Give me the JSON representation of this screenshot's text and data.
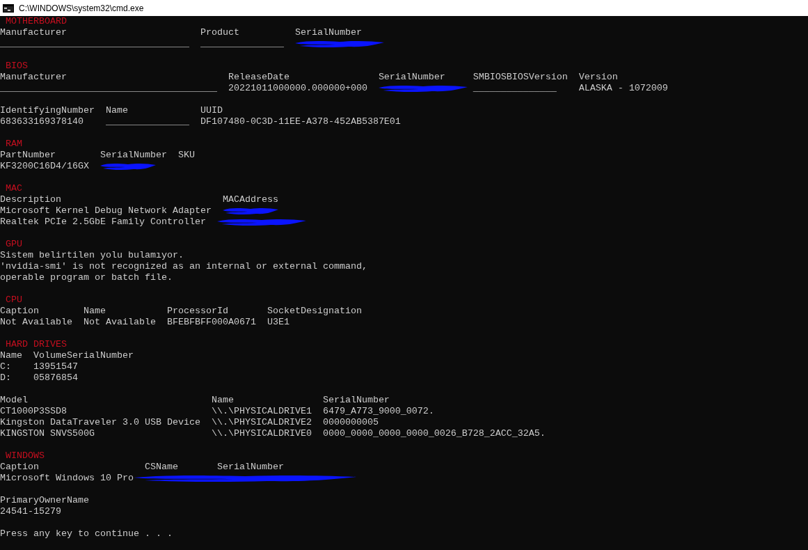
{
  "window": {
    "title": "C:\\WINDOWS\\system32\\cmd.exe"
  },
  "lines": [
    {
      "kind": "heading",
      "text": " MOTHERBOARD"
    },
    {
      "kind": "text",
      "text": "Manufacturer                        Product          SerialNumber"
    },
    {
      "kind": "text",
      "text": "__________________________________  _______________  ",
      "redaction": {
        "kind": "medium"
      }
    },
    {
      "kind": "blank"
    },
    {
      "kind": "heading",
      "text": " BIOS"
    },
    {
      "kind": "text",
      "text": "Manufacturer                             ReleaseDate                SerialNumber     SMBIOSBIOSVersion  Version"
    },
    {
      "kind": "text",
      "text": "_______________________________________  20221011000000.000000+000  ",
      "redaction": {
        "kind": "medium"
      },
      "after": " _______________    ALASKA - 1072009"
    },
    {
      "kind": "blank"
    },
    {
      "kind": "text",
      "text": "IdentifyingNumber  Name             UUID"
    },
    {
      "kind": "text",
      "text": "683633169378140    _______________  DF107480-0C3D-11EE-A378-452AB5387E01"
    },
    {
      "kind": "blank"
    },
    {
      "kind": "heading",
      "text": " RAM"
    },
    {
      "kind": "text",
      "text": "PartNumber        SerialNumber  SKU"
    },
    {
      "kind": "text",
      "text": "KF3200C16D4/16GX  ",
      "redaction": {
        "kind": "short"
      }
    },
    {
      "kind": "blank"
    },
    {
      "kind": "heading",
      "text": " MAC"
    },
    {
      "kind": "text",
      "text": "Description                             MACAddress"
    },
    {
      "kind": "text",
      "text": "Microsoft Kernel Debug Network Adapter  ",
      "redaction": {
        "kind": "short"
      }
    },
    {
      "kind": "text",
      "text": "Realtek PCIe 2.5GbE Family Controller  ",
      "redaction": {
        "kind": "medium"
      }
    },
    {
      "kind": "blank"
    },
    {
      "kind": "heading",
      "text": " GPU"
    },
    {
      "kind": "text",
      "text": "Sistem belirtilen yolu bulamıyor."
    },
    {
      "kind": "text",
      "text": "'nvidia-smi' is not recognized as an internal or external command,"
    },
    {
      "kind": "text",
      "text": "operable program or batch file."
    },
    {
      "kind": "blank"
    },
    {
      "kind": "heading",
      "text": " CPU"
    },
    {
      "kind": "text",
      "text": "Caption        Name           ProcessorId       SocketDesignation"
    },
    {
      "kind": "text",
      "text": "Not Available  Not Available  BFEBFBFF000A0671  U3E1"
    },
    {
      "kind": "blank"
    },
    {
      "kind": "heading",
      "text": " HARD DRIVES"
    },
    {
      "kind": "text",
      "text": "Name  VolumeSerialNumber"
    },
    {
      "kind": "text",
      "text": "C:    13951547"
    },
    {
      "kind": "text",
      "text": "D:    05876854"
    },
    {
      "kind": "blank"
    },
    {
      "kind": "text",
      "text": "Model                                 Name                SerialNumber"
    },
    {
      "kind": "text",
      "text": "CT1000P3SSD8                          \\\\.\\PHYSICALDRIVE1  6479_A773_9000_0072."
    },
    {
      "kind": "text",
      "text": "Kingston DataTraveler 3.0 USB Device  \\\\.\\PHYSICALDRIVE2  0000000005"
    },
    {
      "kind": "text",
      "text": "KINGSTON SNVS500G                     \\\\.\\PHYSICALDRIVE0  0000_0000_0000_0000_0026_B728_2ACC_32A5."
    },
    {
      "kind": "blank"
    },
    {
      "kind": "heading",
      "text": " WINDOWS"
    },
    {
      "kind": "text",
      "text": "Caption                   CSName       SerialNumber"
    },
    {
      "kind": "text",
      "text": "Microsoft Windows 10 Pro",
      "redaction": {
        "kind": "long"
      }
    },
    {
      "kind": "blank"
    },
    {
      "kind": "text",
      "text": "PrimaryOwnerName"
    },
    {
      "kind": "text",
      "text": "24541-15279"
    },
    {
      "kind": "blank"
    },
    {
      "kind": "text",
      "text": "Press any key to continue . . ."
    }
  ]
}
